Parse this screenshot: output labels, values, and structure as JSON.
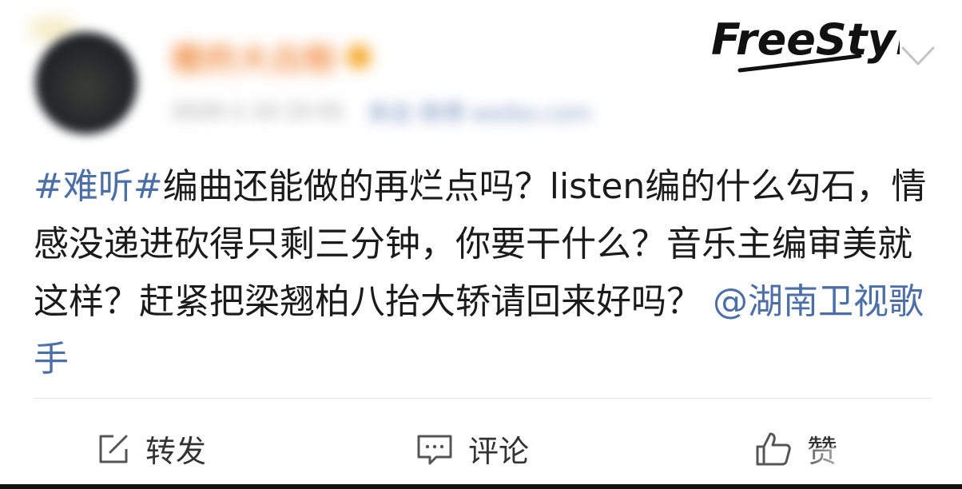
{
  "header": {
    "username": "橙的大白粉",
    "meta_time": "2020-1-10 22:01",
    "meta_source": "来自 微博 weibo.com",
    "watermark": "FreeStyle"
  },
  "post": {
    "hashtag": "#难听#",
    "text1": "编曲还能做的再烂点吗？listen编的什么勾石，情感没递进砍得只剩三分钟，你要干什么？音乐主编审美就这样？赶紧把梁翘柏八抬大轿请回来好吗？",
    "mention": "@湖南卫视歌手"
  },
  "actions": {
    "repost_label": "转发",
    "comment_label": "评论",
    "like_label": "赞"
  },
  "icons": {
    "repost": "repost-icon",
    "comment": "comment-icon",
    "like": "like-icon",
    "more": "chevron-down-icon"
  },
  "colors": {
    "link": "#4c6fa6",
    "text": "#1b1b1b",
    "username": "#f08a3e"
  }
}
